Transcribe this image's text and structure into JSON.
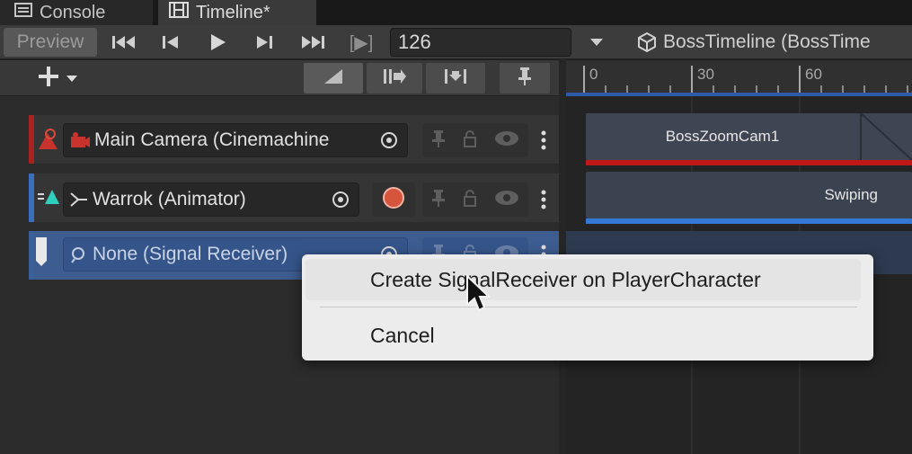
{
  "tabs": [
    {
      "label": "Console",
      "icon": "list-icon"
    },
    {
      "label": "Timeline*",
      "icon": "film-icon"
    }
  ],
  "toolbar": {
    "preview_label": "Preview",
    "current_frame": "126",
    "asset_label": "BossTimeline (BossTime",
    "play_range_glyph": "[▶]"
  },
  "ruler": {
    "ticks": [
      "0",
      "30",
      "60"
    ]
  },
  "tracks": [
    {
      "name": "Main Camera (Cinemachine",
      "accent": "#a82222",
      "clip": "BossZoomCam1",
      "clip_line": "#c01818"
    },
    {
      "name": "Warrok (Animator)",
      "accent": "#3a6fbf",
      "clip": "Swiping",
      "clip_line": "#3477d4"
    },
    {
      "name": "None (Signal Receiver)",
      "accent": "#3b5f99",
      "clip": "",
      "clip_line": ""
    }
  ],
  "context_menu": {
    "items": [
      "Create SignalReceiver on PlayerCharacter",
      "Cancel"
    ]
  },
  "colors": {
    "selected_track_bg": "#3d5c8f",
    "record_button": "#d4553c",
    "menu_bg": "#ececec"
  }
}
